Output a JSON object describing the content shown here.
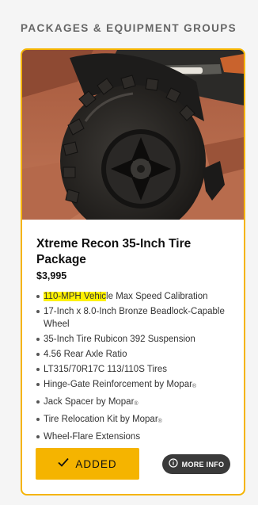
{
  "section": {
    "heading": "PACKAGES & EQUIPMENT GROUPS"
  },
  "card": {
    "title": "Xtreme Recon 35-Inch Tire Package",
    "price": "$3,995",
    "accent_color": "#f5b400",
    "image_alt": "Close-up of a large off-road tire on a red rock trail",
    "features": [
      {
        "text": "110-MPH Vehicle Max Speed Calibration",
        "highlight": "110-MPH Vehic",
        "rest": "le Max Speed Calibration",
        "reg": ""
      },
      {
        "text": "17-Inch x 8.0-Inch Bronze Beadlock-Capable Wheel",
        "highlight": "",
        "rest": "17-Inch x 8.0-Inch Bronze Beadlock-Capable Wheel",
        "reg": ""
      },
      {
        "text": "35-Inch Tire Rubicon 392 Suspension",
        "highlight": "",
        "rest": "35-Inch Tire Rubicon 392 Suspension",
        "reg": ""
      },
      {
        "text": "4.56 Rear Axle Ratio",
        "highlight": "",
        "rest": "4.56 Rear Axle Ratio",
        "reg": ""
      },
      {
        "text": "LT315/70R17C 113/110S Tires",
        "highlight": "",
        "rest": "LT315/70R17C 113/110S Tires",
        "reg": ""
      },
      {
        "text": "Hinge-Gate Reinforcement by Mopar",
        "highlight": "",
        "rest": "Hinge-Gate Reinforcement by Mopar",
        "reg": "®"
      },
      {
        "text": "Jack Spacer by Mopar",
        "highlight": "",
        "rest": "Jack Spacer by Mopar",
        "reg": "®"
      },
      {
        "text": "Tire Relocation Kit by Mopar",
        "highlight": "",
        "rest": "Tire Relocation Kit by Mopar",
        "reg": "®"
      },
      {
        "text": "Wheel-Flare Extensions",
        "highlight": "",
        "rest": "Wheel-Flare Extensions",
        "reg": ""
      }
    ],
    "added_button": {
      "icon": "checkmark-icon",
      "label": "ADDED"
    },
    "more_info_button": {
      "icon": "info-circle-icon",
      "label": "MORE INFO"
    }
  }
}
